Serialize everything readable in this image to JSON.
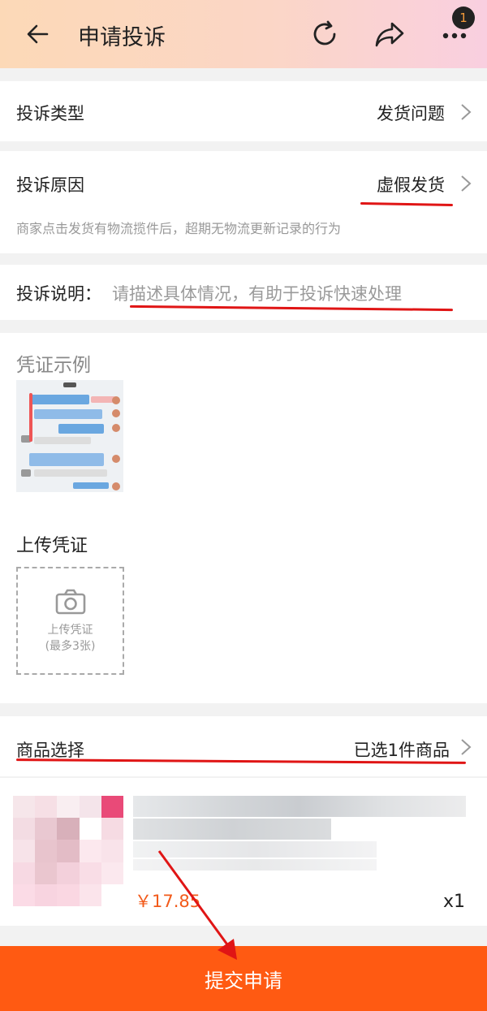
{
  "header": {
    "title": "申请投诉",
    "back_icon": "arrow-left-icon",
    "refresh_icon": "refresh-icon",
    "share_icon": "share-icon",
    "more_icon": "more-icon",
    "badge_count": "1"
  },
  "complaint_type": {
    "label": "投诉类型",
    "value": "发货问题"
  },
  "complaint_reason": {
    "label": "投诉原因",
    "value": "虚假发货",
    "description": "商家点击发货有物流揽件后，超期无物流更新记录的行为"
  },
  "complaint_desc": {
    "label": "投诉说明：",
    "placeholder": "请描述具体情况，有助于投诉快速处理"
  },
  "evidence": {
    "sample_title": "凭证示例",
    "upload_title": "上传凭证",
    "upload_label": "上传凭证",
    "upload_limit": "(最多3张)"
  },
  "product": {
    "label": "商品选择",
    "value": "已选1件商品",
    "price": "￥17.85",
    "qty": "x1"
  },
  "submit_label": "提交申请",
  "colors": {
    "accent": "#ff5a12",
    "annotation": "#e01515",
    "price": "#f25a1a"
  }
}
